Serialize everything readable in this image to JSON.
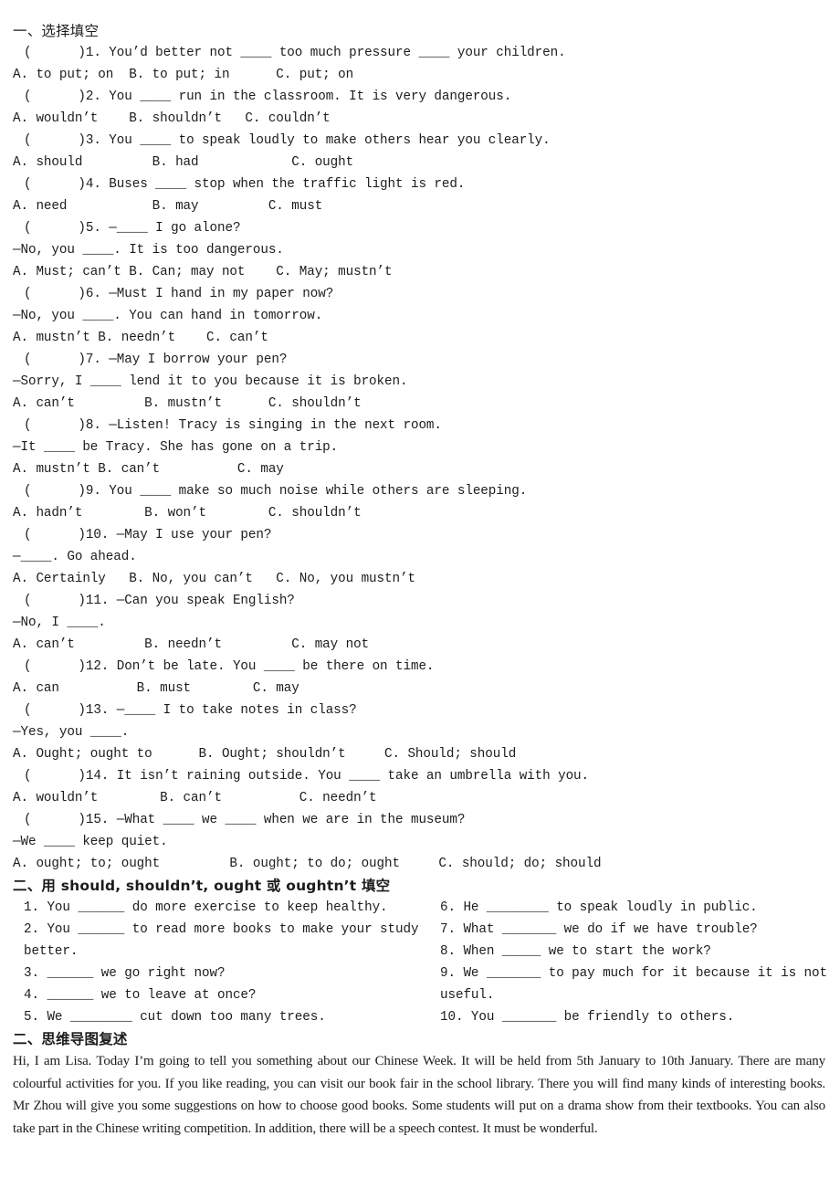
{
  "document": {
    "sections": [
      {
        "id": "section-one",
        "heading": "一、选择填空",
        "heading_bold": false,
        "lines": [
          {
            "type": "question",
            "text": "(      )1. You’d better not ____ too much pressure ____ your children."
          },
          {
            "type": "options",
            "text": "A. to put; on  B. to put; in      C. put; on"
          },
          {
            "type": "question",
            "text": "(      )2. You ____ run in the classroom. It is very dangerous."
          },
          {
            "type": "options",
            "text": "A. wouldn’t    B. shouldn’t   C. couldn’t"
          },
          {
            "type": "question",
            "text": "(      )3. You ____ to speak loudly to make others hear you clearly."
          },
          {
            "type": "options",
            "text": "A. should         B. had            C. ought"
          },
          {
            "type": "question",
            "text": "(      )4. Buses ____ stop when the traffic light is red."
          },
          {
            "type": "options",
            "text": "A. need           B. may         C. must"
          },
          {
            "type": "question",
            "text": "(      )5. —____ I go alone?"
          },
          {
            "type": "dialogue",
            "text": "—No, you ____. It is too dangerous."
          },
          {
            "type": "options",
            "text": "A. Must; can’t B. Can; may not    C. May; mustn’t"
          },
          {
            "type": "question",
            "text": "(      )6. —Must I hand in my paper now?"
          },
          {
            "type": "dialogue",
            "text": "—No, you ____. You can hand in tomorrow."
          },
          {
            "type": "options",
            "text": "A. mustn’t B. needn’t    C. can’t"
          },
          {
            "type": "question",
            "text": "(      )7. —May I borrow your pen?"
          },
          {
            "type": "dialogue",
            "text": "—Sorry, I ____ lend it to you because it is broken."
          },
          {
            "type": "options",
            "text": "A. can’t         B. mustn’t      C. shouldn’t"
          },
          {
            "type": "question",
            "text": "(      )8. —Listen! Tracy is singing in the next room."
          },
          {
            "type": "dialogue",
            "text": "—It ____ be Tracy. She has gone on a trip."
          },
          {
            "type": "options",
            "text": "A. mustn’t B. can’t          C. may"
          },
          {
            "type": "question",
            "text": "(      )9. You ____ make so much noise while others are sleeping."
          },
          {
            "type": "options",
            "text": "A. hadn’t        B. won’t        C. shouldn’t"
          },
          {
            "type": "question",
            "text": "(      )10. —May I use your pen?"
          },
          {
            "type": "dialogue",
            "text": "—____. Go ahead."
          },
          {
            "type": "options",
            "text": "A. Certainly   B. No, you can’t   C. No, you mustn’t"
          },
          {
            "type": "question",
            "text": "(      )11. —Can you speak English?"
          },
          {
            "type": "dialogue",
            "text": "—No, I ____."
          },
          {
            "type": "options",
            "text": "A. can’t         B. needn’t         C. may not"
          },
          {
            "type": "question",
            "text": "(      )12. Don’t be late. You ____ be there on time."
          },
          {
            "type": "options",
            "text": "A. can          B. must        C. may"
          },
          {
            "type": "question",
            "text": "(      )13. —____ I to take notes in class?"
          },
          {
            "type": "dialogue",
            "text": "—Yes, you ____."
          },
          {
            "type": "options",
            "text": "A. Ought; ought to      B. Ought; shouldn’t     C. Should; should"
          },
          {
            "type": "question",
            "text": "(      )14. It isn’t raining outside. You ____ take an umbrella with you."
          },
          {
            "type": "options",
            "text": "A. wouldn’t        B. can’t          C. needn’t"
          },
          {
            "type": "question",
            "text": "(      )15. —What ____ we ____ when we are in the museum?"
          },
          {
            "type": "dialogue",
            "text": "—We ____ keep quiet."
          },
          {
            "type": "options",
            "text": "A. ought; to; ought         B. ought; to do; ought     C. should; do; should"
          }
        ]
      }
    ],
    "section_two": {
      "id": "section-two",
      "heading": "二、用 should, shouldn’t, ought 或 oughtn’t 填空",
      "heading_bold": true,
      "left_items": [
        "1. You ______ do more exercise to keep healthy.",
        "2. You ______ to read more books to make your study better.",
        "3. ______ we go right now?",
        "4. ______ we to leave at once?",
        "5. We ________ cut down too many trees."
      ],
      "right_items": [
        "6. He ________ to speak loudly in public.",
        "7. What _______ we do if we have trouble?",
        "8. When _____ we to start the work?",
        "9. We _______ to pay much for it because it is not useful.",
        "10. You _______ be friendly to others."
      ]
    },
    "section_three": {
      "id": "section-three",
      "heading": "二、思维导图复述",
      "heading_bold": true,
      "passage": "Hi, I am Lisa. Today I’m going to tell you something about our Chinese Week. It will be held from 5th January to 10th January. There are many colourful activities for you. If you like reading, you can visit our book fair in the school library. There you will find many kinds of interesting books. Mr Zhou will give you some suggestions on how to choose good books. Some students will put on a drama show from their textbooks. You can also take part in the Chinese writing competition. In addition, there will be a speech contest. It must be wonderful."
    }
  }
}
